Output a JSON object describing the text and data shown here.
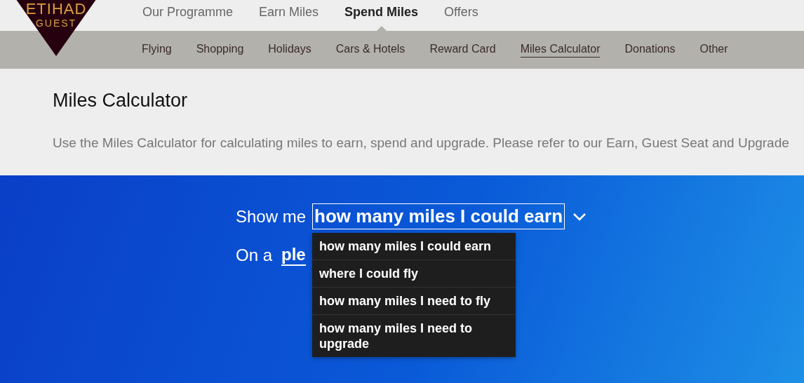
{
  "logo": {
    "brand": "ETIHAD",
    "sub": "GUEST"
  },
  "main_nav": [
    {
      "label": "Our Programme",
      "selected": false
    },
    {
      "label": "Earn Miles",
      "selected": false
    },
    {
      "label": "Spend Miles",
      "selected": true
    },
    {
      "label": "Offers",
      "selected": false
    }
  ],
  "sub_nav": [
    {
      "label": "Flying",
      "selected": false
    },
    {
      "label": "Shopping",
      "selected": false
    },
    {
      "label": "Holidays",
      "selected": false
    },
    {
      "label": "Cars & Hotels",
      "selected": false
    },
    {
      "label": "Reward Card",
      "selected": false
    },
    {
      "label": "Miles Calculator",
      "selected": true
    },
    {
      "label": "Donations",
      "selected": false
    },
    {
      "label": "Other",
      "selected": false
    }
  ],
  "page": {
    "title": "Miles Calculator",
    "description": "Use the Miles Calculator for calculating miles to earn, spend and upgrade. Please refer to our Earn, Guest Seat and Upgrade"
  },
  "calculator": {
    "show_label": "Show me",
    "show_value": "how many miles I could earn",
    "on_label": "On a",
    "on_value": "ple",
    "options": [
      {
        "label": "how many miles I could earn"
      },
      {
        "label": "where I could fly"
      },
      {
        "label": "how many miles I need to fly"
      },
      {
        "label": "how many miles I need to upgrade"
      }
    ]
  }
}
